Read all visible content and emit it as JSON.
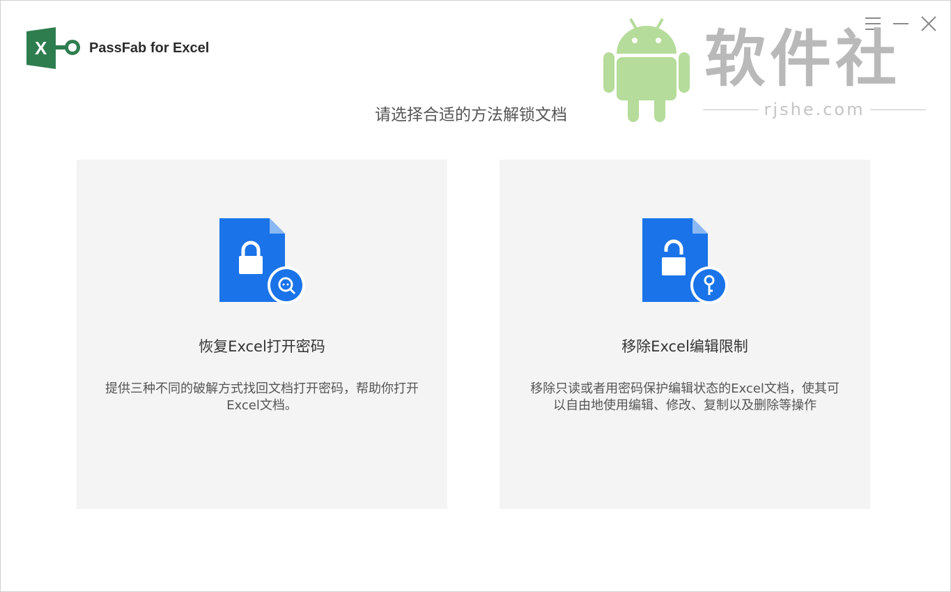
{
  "app": {
    "title": "PassFab for Excel",
    "accent_color": "#1a73e8",
    "logo_color": "#2e7d4f"
  },
  "window_controls": {
    "menu_icon": "hamburger-icon",
    "minimize_icon": "minimize-icon",
    "close_icon": "close-icon"
  },
  "watermark": {
    "title": "软件社",
    "subtitle": "rjshe.com",
    "icon": "android-icon"
  },
  "main": {
    "heading": "请选择合适的方法解锁文档",
    "options": [
      {
        "title": "恢复Excel打开密码",
        "description": "提供三种不同的破解方式找回文档打开密码，帮助你打开Excel文档。",
        "icon": "locked-document-search-icon"
      },
      {
        "title": "移除Excel编辑限制",
        "description": "移除只读或者用密码保护编辑状态的Excel文档，使其可以自由地使用编辑、修改、复制以及删除等操作",
        "icon": "unlocked-document-key-icon"
      }
    ]
  }
}
